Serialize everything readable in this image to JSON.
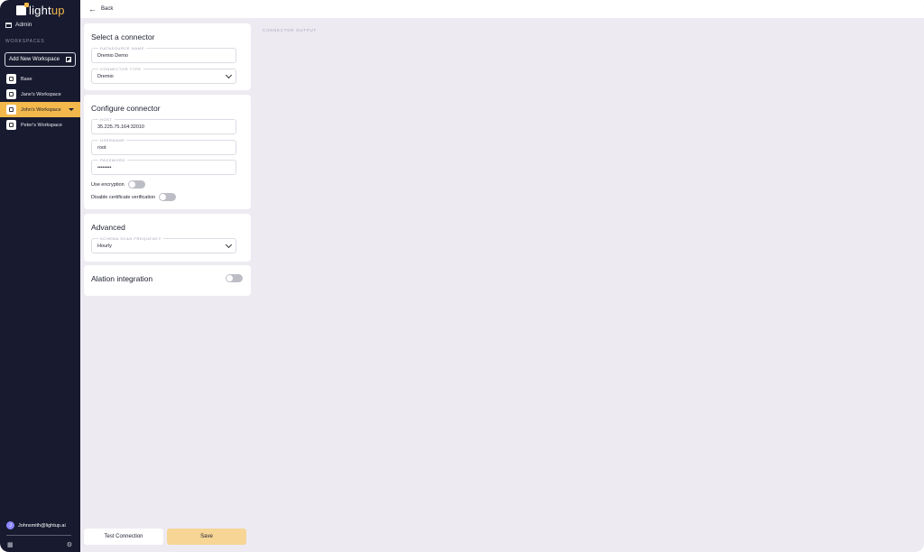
{
  "brand": {
    "logo_left": "light",
    "logo_right": "up",
    "accent_color": "#f2b84b",
    "sidebar_bg": "#181a2f"
  },
  "sidebar": {
    "admin_label": "Admin",
    "workspaces_title": "WORKSPACES",
    "add_workspace_label": "Add New Workspace",
    "items": [
      {
        "label": "Base",
        "active": false
      },
      {
        "label": "Jane's Workspace",
        "active": false
      },
      {
        "label": "John's Workspace",
        "active": true
      },
      {
        "label": "Peter's Workspace",
        "active": false
      }
    ],
    "user": {
      "initial": "J",
      "email": "Johnsmith@lightup.ai"
    }
  },
  "topbar": {
    "back_label": "Back"
  },
  "select_connector": {
    "title": "Select a connector",
    "datasource_name": {
      "label": "DATASOURCE NAME",
      "value": "Dremio Demo"
    },
    "connector_type": {
      "label": "CONNECTOR TYPE",
      "value": "Dremio"
    }
  },
  "configure": {
    "title": "Configure connector",
    "host": {
      "label": "HOST",
      "value": "35.225.75.164:32010"
    },
    "username": {
      "label": "USERNAME",
      "value": "root"
    },
    "password": {
      "label": "PASSWORD",
      "value": "••••••••"
    },
    "use_encryption": {
      "label": "Use encryption",
      "on": false
    },
    "disable_cert": {
      "label": "Disable certificate verification",
      "on": false
    }
  },
  "advanced": {
    "title": "Advanced",
    "schema_scan": {
      "label": "SCHEMA SCAN FREQUENCY",
      "value": "Hourly"
    }
  },
  "alation": {
    "title": "Alation integration",
    "on": false
  },
  "output": {
    "label": "CONNECTOR OUTPUT"
  },
  "actions": {
    "test_label": "Test Connection",
    "save_label": "Save"
  }
}
